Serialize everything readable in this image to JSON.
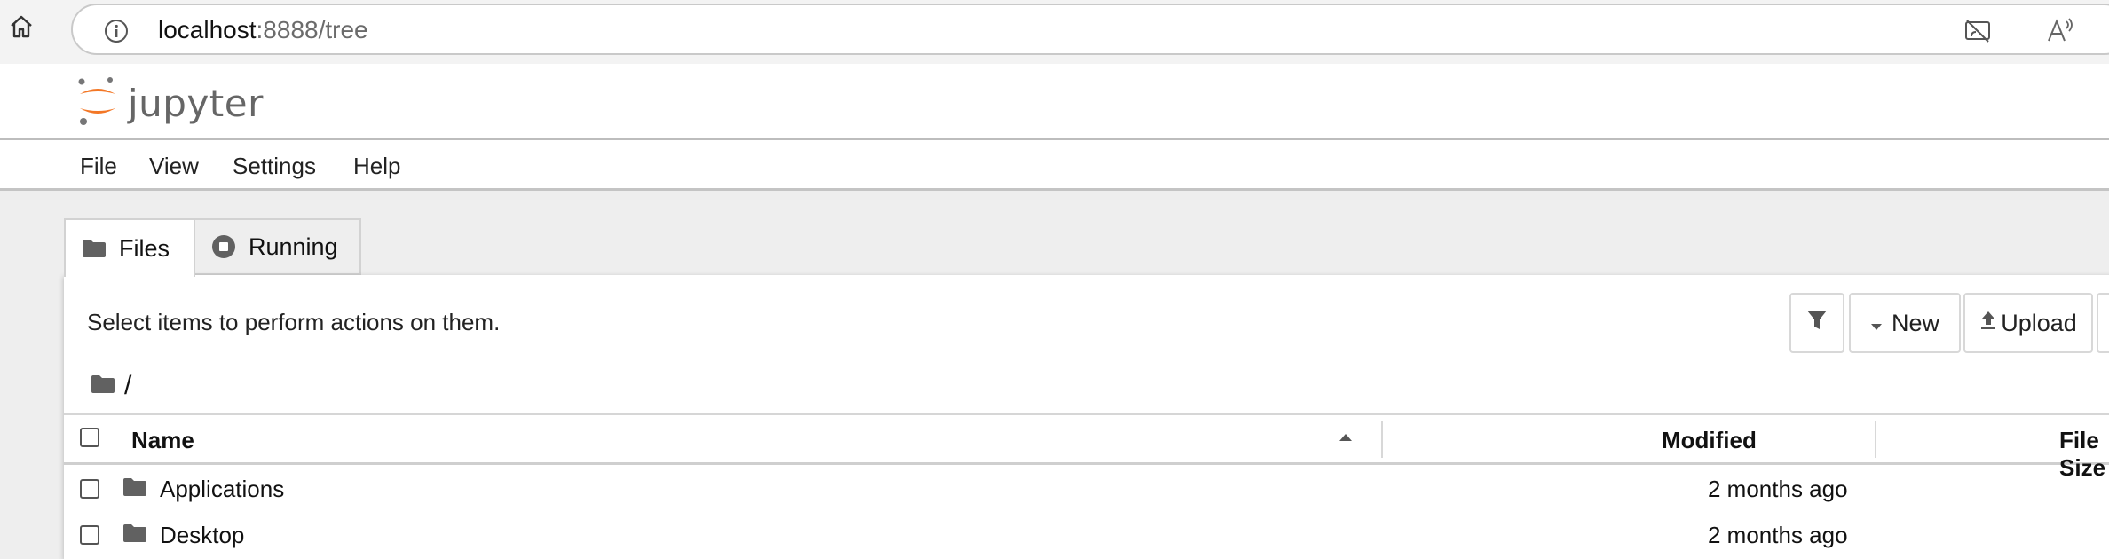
{
  "browser": {
    "url_host": "localhost",
    "url_rest": ":8888/tree",
    "icons": [
      "home-icon",
      "info-icon",
      "cast-off-icon",
      "read-aloud-icon"
    ]
  },
  "header": {
    "logo_text": "jupyter",
    "logo_colors": {
      "orange": "#F37726",
      "gray": "#767677"
    }
  },
  "menu": {
    "items": [
      {
        "label": "File"
      },
      {
        "label": "View"
      },
      {
        "label": "Settings"
      },
      {
        "label": "Help"
      }
    ]
  },
  "tabs": [
    {
      "label": "Files",
      "icon": "folder-icon",
      "active": true
    },
    {
      "label": "Running",
      "icon": "stop-circle-icon",
      "active": false
    }
  ],
  "panel": {
    "hint": "Select items to perform actions on them.",
    "toolbar": {
      "filter_icon": "filter-icon",
      "new_label": "New",
      "upload_label": "Upload"
    },
    "breadcrumb": "/"
  },
  "table": {
    "headers": {
      "name": "Name",
      "modified": "Modified",
      "size": "File Size"
    },
    "sort": "name-ascending",
    "rows": [
      {
        "name": "Applications",
        "type": "folder",
        "modified": "2 months ago"
      },
      {
        "name": "Desktop",
        "type": "folder",
        "modified": "2 months ago"
      }
    ]
  }
}
